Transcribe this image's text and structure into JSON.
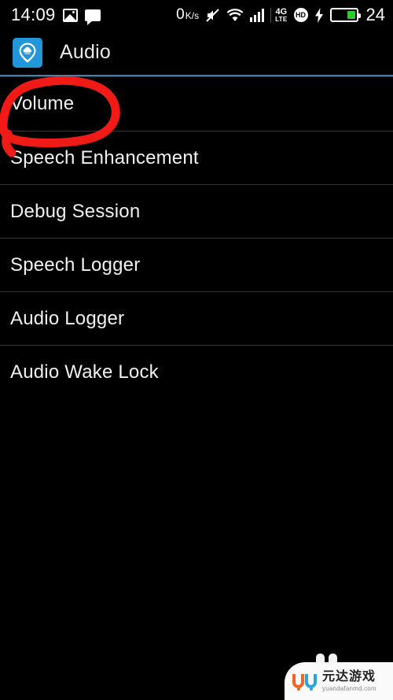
{
  "status_bar": {
    "clock": "14:09",
    "left_icons": [
      "photo-icon",
      "message-icon"
    ],
    "network_speed": "0",
    "network_speed_unit": "K/s",
    "right_icons": [
      "mute-icon",
      "wifi-icon",
      "signal-icon",
      "4g-lte-icon",
      "hd-icon",
      "charging-bolt-icon",
      "battery-icon"
    ],
    "lte_top": "4G",
    "lte_bottom": "LTE",
    "hd_label": "HD",
    "battery_percent": "24",
    "battery_fill_pct": 34,
    "battery_color": "#2ecc2e"
  },
  "app_bar": {
    "icon_name": "cloud-pin-icon",
    "icon_bg": "#2196d8",
    "title": "Audio"
  },
  "accent_color": "#4a7fa8",
  "list": {
    "items": [
      {
        "label": "Volume"
      },
      {
        "label": "Speech Enhancement"
      },
      {
        "label": "Debug Session"
      },
      {
        "label": "Speech Logger"
      },
      {
        "label": "Audio Logger"
      },
      {
        "label": "Audio Wake Lock"
      }
    ]
  },
  "annotation": {
    "type": "hand-drawn-circle",
    "target": "Volume",
    "color": "#f01a16"
  },
  "watermark": {
    "logo_left": "U",
    "logo_right": "U",
    "brand_cn": "元达游戏",
    "url": "yuandafanmd.com",
    "color_left": "#f26522",
    "color_right": "#29a3dc"
  }
}
